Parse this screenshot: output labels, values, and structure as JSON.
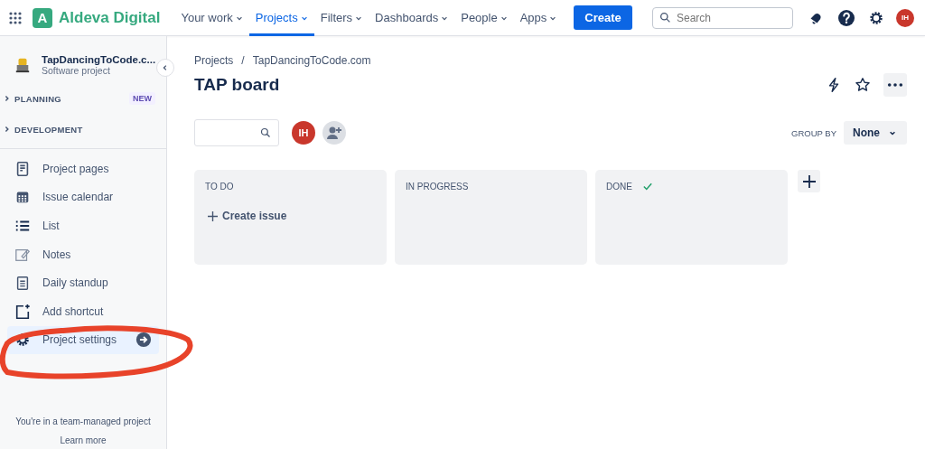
{
  "topnav": {
    "app_name": "Aldeva Digital",
    "logo_letter": "A",
    "menu": [
      {
        "label": "Your work",
        "selected": false
      },
      {
        "label": "Projects",
        "selected": true
      },
      {
        "label": "Filters",
        "selected": false
      },
      {
        "label": "Dashboards",
        "selected": false
      },
      {
        "label": "People",
        "selected": false
      },
      {
        "label": "Apps",
        "selected": false
      }
    ],
    "create_button": "Create",
    "search": {
      "placeholder": "Search"
    },
    "avatar": "IH"
  },
  "sidebar": {
    "project_name": "TapDancingToCode.c...",
    "project_type": "Software project",
    "sections": [
      {
        "label": "PLANNING",
        "badge": "NEW"
      },
      {
        "label": "DEVELOPMENT"
      }
    ],
    "items": [
      {
        "label": "Project pages",
        "kind": "page",
        "selected": false
      },
      {
        "label": "Issue calendar",
        "kind": "calendar",
        "selected": false
      },
      {
        "label": "List",
        "kind": "list",
        "selected": false
      },
      {
        "label": "Notes",
        "kind": "notes",
        "selected": false
      },
      {
        "label": "Daily standup",
        "kind": "clipboard",
        "selected": false
      },
      {
        "label": "Add shortcut",
        "kind": "add",
        "selected": false
      },
      {
        "label": "Project settings",
        "kind": "gear",
        "selected": true
      }
    ],
    "footer": "You're in a team-managed project",
    "footer_link": "Learn more"
  },
  "breadcrumb": [
    "Projects",
    "TapDancingToCode.com"
  ],
  "breadcrumb_separator": "/",
  "title": "TAP board",
  "filters": {
    "avatar": "IH",
    "group_by_label": "GROUP BY",
    "group_by_value": "None"
  },
  "columns": [
    {
      "title": "TO DO",
      "done": false,
      "create_label": "Create issue"
    },
    {
      "title": "IN PROGRESS",
      "done": false
    },
    {
      "title": "DONE",
      "done": true
    }
  ]
}
